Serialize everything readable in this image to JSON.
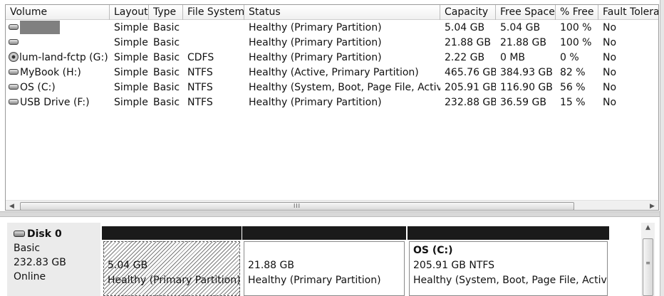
{
  "columns": [
    "Volume",
    "Layout",
    "Type",
    "File System",
    "Status",
    "Capacity",
    "Free Space",
    "% Free",
    "Fault Tolera"
  ],
  "volumes": [
    {
      "name": "",
      "layout": "Simple",
      "type": "Basic",
      "fs": "",
      "status": "Healthy (Primary Partition)",
      "capacity": "5.04 GB",
      "free": "5.04 GB",
      "pct": "100 %",
      "fault": "No",
      "icon": "drive-icon",
      "redacted": true
    },
    {
      "name": "",
      "layout": "Simple",
      "type": "Basic",
      "fs": "",
      "status": "Healthy (Primary Partition)",
      "capacity": "21.88 GB",
      "free": "21.88 GB",
      "pct": "100 %",
      "fault": "No",
      "icon": "drive-icon"
    },
    {
      "name": "lum-land-fctp (G:)",
      "layout": "Simple",
      "type": "Basic",
      "fs": "CDFS",
      "status": "Healthy (Primary Partition)",
      "capacity": "2.22 GB",
      "free": "0 MB",
      "pct": "0 %",
      "fault": "No",
      "icon": "cd-drive-icon"
    },
    {
      "name": "MyBook (H:)",
      "layout": "Simple",
      "type": "Basic",
      "fs": "NTFS",
      "status": "Healthy (Active, Primary Partition)",
      "capacity": "465.76 GB",
      "free": "384.93 GB",
      "pct": "82 %",
      "fault": "No",
      "icon": "drive-icon"
    },
    {
      "name": "OS (C:)",
      "layout": "Simple",
      "type": "Basic",
      "fs": "NTFS",
      "status": "Healthy (System, Boot, Page File, Activ...",
      "capacity": "205.91 GB",
      "free": "116.90 GB",
      "pct": "56 %",
      "fault": "No",
      "icon": "drive-icon"
    },
    {
      "name": "USB Drive (F:)",
      "layout": "Simple",
      "type": "Basic",
      "fs": "NTFS",
      "status": "Healthy (Primary Partition)",
      "capacity": "232.88 GB",
      "free": "36.59 GB",
      "pct": "15 %",
      "fault": "No",
      "icon": "drive-icon"
    }
  ],
  "scrollbar": {
    "grip": "III",
    "left_arrow": "◀",
    "right_arrow": "▶",
    "up_arrow": "▲",
    "v_grip": "≡"
  },
  "disk": {
    "title": "Disk 0",
    "type": "Basic",
    "size": "232.83 GB",
    "state": "Online"
  },
  "partitions": [
    {
      "name": "",
      "line1": "5.04 GB",
      "line2": "Healthy (Primary Partition)",
      "hatched": true
    },
    {
      "name": "",
      "line1": "21.88 GB",
      "line2": "Healthy (Primary Partition)",
      "hatched": false
    },
    {
      "name": "OS  (C:)",
      "line1": "205.91 GB NTFS",
      "line2": "Healthy (System, Boot, Page File, Active,",
      "hatched": false
    }
  ]
}
